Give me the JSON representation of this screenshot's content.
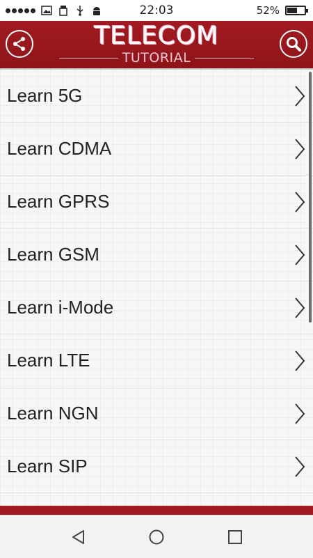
{
  "status_bar": {
    "time": "22:03",
    "battery_percent_text": "52%",
    "battery_level": 0.52,
    "icons": [
      "signal-dots-icon",
      "image-icon",
      "usb-storage-icon",
      "usb-icon",
      "android-icon",
      "battery-icon"
    ]
  },
  "header": {
    "title": "TELECOM",
    "subtitle": "TUTORIAL",
    "background_color": "#a11b21",
    "left_icon": "share-icon",
    "right_icon": "search-icon"
  },
  "list": {
    "items": [
      {
        "label": "Learn 5G"
      },
      {
        "label": "Learn CDMA"
      },
      {
        "label": "Learn GPRS"
      },
      {
        "label": "Learn GSM"
      },
      {
        "label": "Learn i-Mode"
      },
      {
        "label": "Learn LTE"
      },
      {
        "label": "Learn NGN"
      },
      {
        "label": "Learn SIP"
      }
    ],
    "item_icon": "chevron-right-icon"
  },
  "nav_bar": {
    "icons": [
      "back-icon",
      "home-icon",
      "recent-apps-icon"
    ]
  }
}
